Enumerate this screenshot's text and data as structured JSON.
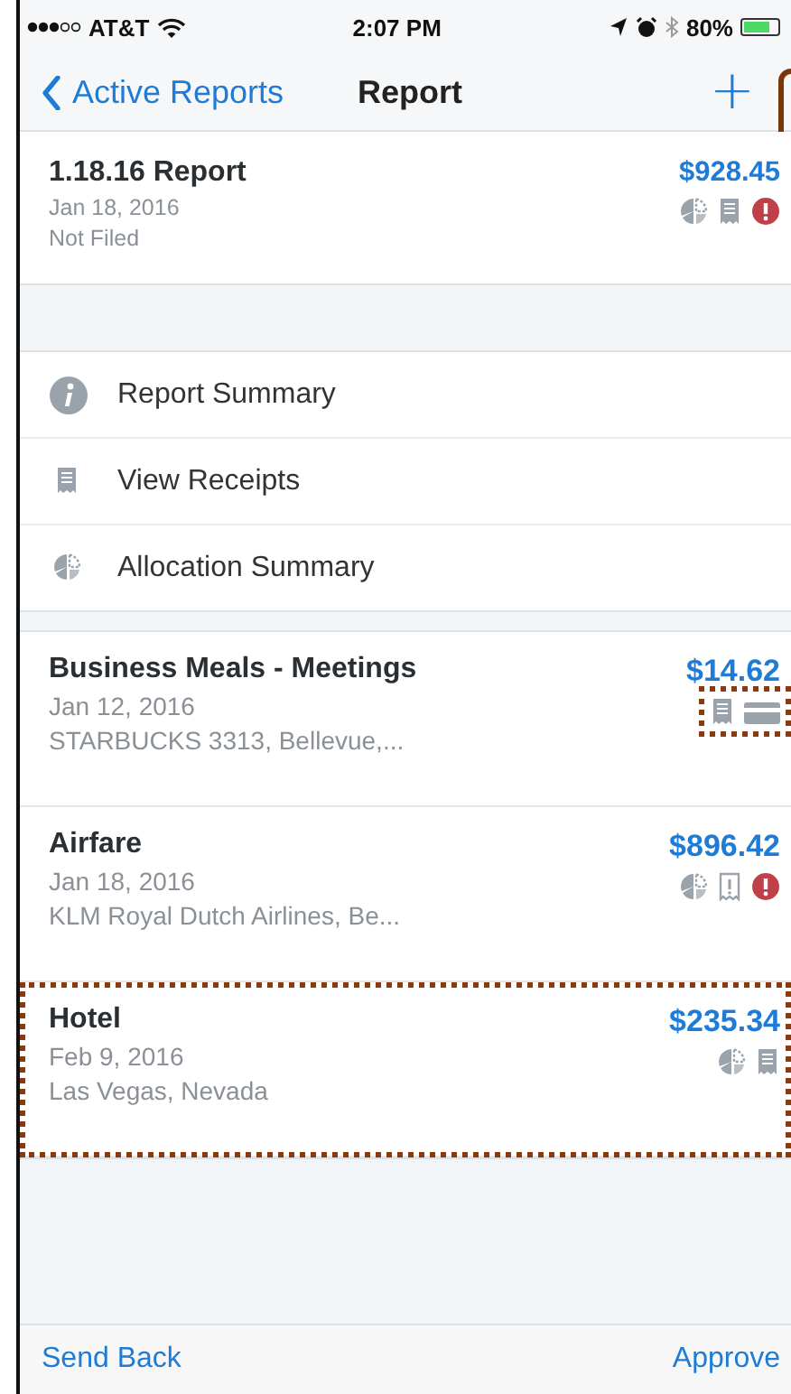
{
  "status_bar": {
    "carrier": "AT&T",
    "time": "2:07 PM",
    "battery": "80%"
  },
  "nav": {
    "back": "Active Reports",
    "title": "Report",
    "action": "+"
  },
  "report": {
    "title": "1.18.16 Report",
    "amount": "$928.45",
    "date": "Jan 18, 2016",
    "status": "Not Filed",
    "icons": [
      {
        "kind": "allocation"
      },
      {
        "kind": "receipt"
      },
      {
        "kind": "alert"
      }
    ],
    "callout": {
      "kind": "frame"
    }
  },
  "menu": [
    {
      "label": "Report Summary",
      "kind": "info"
    },
    {
      "label": "View Receipts",
      "kind": "receipt"
    },
    {
      "label": "Allocation Summary",
      "kind": "allocation"
    }
  ],
  "expenses": [
    {
      "title": "Business Meals - Meetings",
      "amount": "$14.62",
      "date": "Jan 12, 2016",
      "vendor": "STARBUCKS 3313, Bellevue,...",
      "icons": [
        {
          "kind": "receipt"
        },
        {
          "kind": "card"
        }
      ],
      "callout": {
        "kind": "icons"
      }
    },
    {
      "title": "Airfare",
      "amount": "$896.42",
      "date": "Jan 18, 2016",
      "vendor": "KLM Royal Dutch Airlines, Be...",
      "icons": [
        {
          "kind": "allocation"
        },
        {
          "kind": "missing-receipt"
        },
        {
          "kind": "alert"
        }
      ]
    },
    {
      "title": "Hotel",
      "amount": "$235.34",
      "date": "Feb 9, 2016",
      "vendor": "Las Vegas, Nevada",
      "icons": [
        {
          "kind": "allocation"
        },
        {
          "kind": "receipt"
        }
      ],
      "callout": {
        "kind": "row"
      }
    }
  ],
  "toolbar": {
    "left": "Send Back",
    "right": "Approve"
  }
}
